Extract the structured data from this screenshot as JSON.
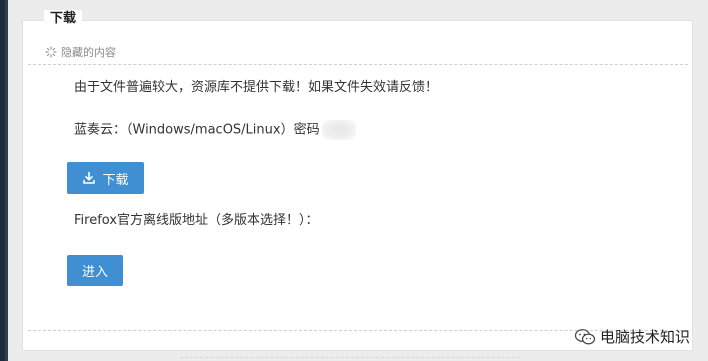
{
  "panel": {
    "title": "下载"
  },
  "hidden_content": {
    "label": "隐藏的内容",
    "icon": "spinner-icon"
  },
  "content": {
    "notice": "由于文件普遍较大，资源库不提供下载！如果文件失效请反馈！",
    "lanzou_line": "蓝奏云：（Windows/macOS/Linux）密码",
    "download_button": "下载",
    "firefox_line": "Firefox官方离线版地址（多版本选择！）：",
    "enter_button": "进入"
  },
  "watermark": {
    "text": "电脑技术知识",
    "icon": "wechat-icon"
  },
  "colors": {
    "button": "#3f8fd2",
    "panel_border": "#e1e1e1"
  }
}
